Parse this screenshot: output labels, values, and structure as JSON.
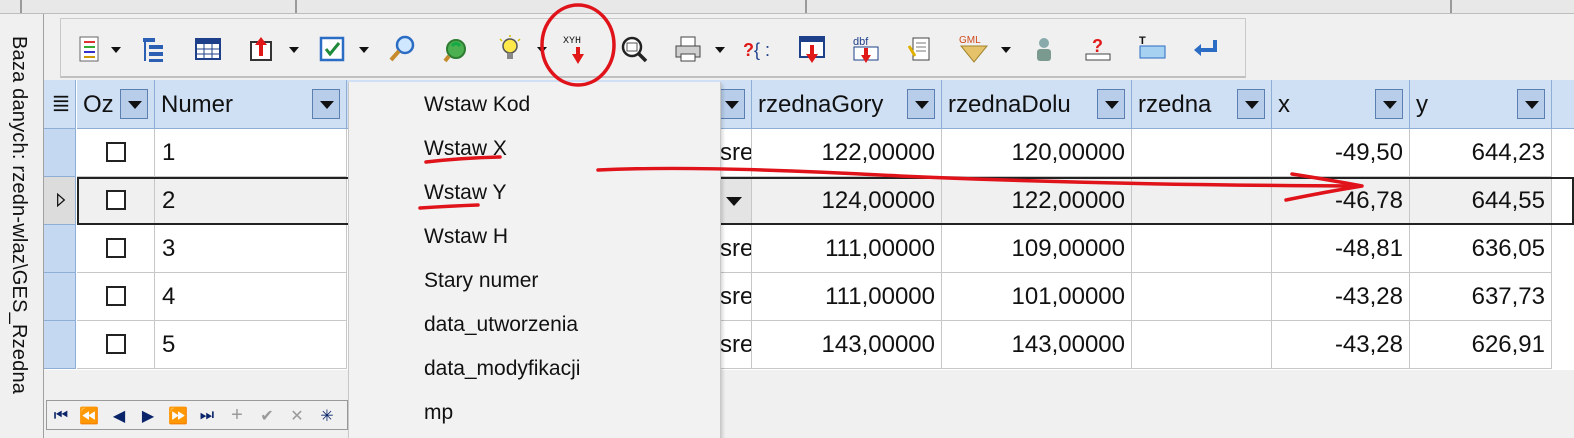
{
  "side_label": "Baza danych: rzedn-wlaz\\GES_Rzedna",
  "toolbar": {
    "buttons": [
      {
        "name": "list-icon"
      },
      {
        "name": "tree-icon"
      },
      {
        "name": "table-icon"
      },
      {
        "name": "export-icon"
      },
      {
        "name": "checkbox-icon"
      },
      {
        "name": "search-icon"
      },
      {
        "name": "refresh-icon"
      },
      {
        "name": "bulb-icon"
      },
      {
        "name": "xyh-insert-icon",
        "label": "XYH"
      },
      {
        "name": "zoom-icon"
      },
      {
        "name": "printer-icon"
      },
      {
        "name": "help-bracket-icon"
      },
      {
        "name": "import-table-icon"
      },
      {
        "name": "dbf-icon",
        "label": "dbf"
      },
      {
        "name": "attach-icon"
      },
      {
        "name": "gml-icon",
        "label": "GML"
      },
      {
        "name": "user-icon"
      },
      {
        "name": "question-icon"
      },
      {
        "name": "text-field-icon"
      },
      {
        "name": "undo-arrow-icon"
      }
    ]
  },
  "grid": {
    "columns": [
      "Oz",
      "Numer",
      "rzednaGory",
      "rzednaDolu",
      "rzedna",
      "x",
      "y"
    ],
    "rows": [
      {
        "numer": "1",
        "trunc": "sre",
        "rzednaGory": "122,00000",
        "rzednaDolu": "120,00000",
        "x": "-49,50",
        "y": "644,23"
      },
      {
        "numer": "2",
        "trunc": "",
        "rzednaGory": "124,00000",
        "rzednaDolu": "122,00000",
        "x": "-46,78",
        "y": "644,55"
      },
      {
        "numer": "3",
        "trunc": "sre",
        "rzednaGory": "111,00000",
        "rzednaDolu": "109,00000",
        "x": "-48,81",
        "y": "636,05"
      },
      {
        "numer": "4",
        "trunc": "sre",
        "rzednaGory": "111,00000",
        "rzednaDolu": "101,00000",
        "x": "-43,28",
        "y": "637,73"
      },
      {
        "numer": "5",
        "trunc": "sre",
        "rzednaGory": "143,00000",
        "rzednaDolu": "143,00000",
        "x": "-43,28",
        "y": "626,91"
      }
    ]
  },
  "menu": {
    "items": [
      "Wstaw Kod",
      "Wstaw X",
      "Wstaw Y",
      "Wstaw H",
      "Stary numer",
      "data_utworzenia",
      "data_modyfikacji",
      "mp"
    ]
  },
  "colors": {
    "header_bg": "#cfe0f5",
    "annotation_red": "#e0131a",
    "menu_bg": "#f2f2f2"
  }
}
